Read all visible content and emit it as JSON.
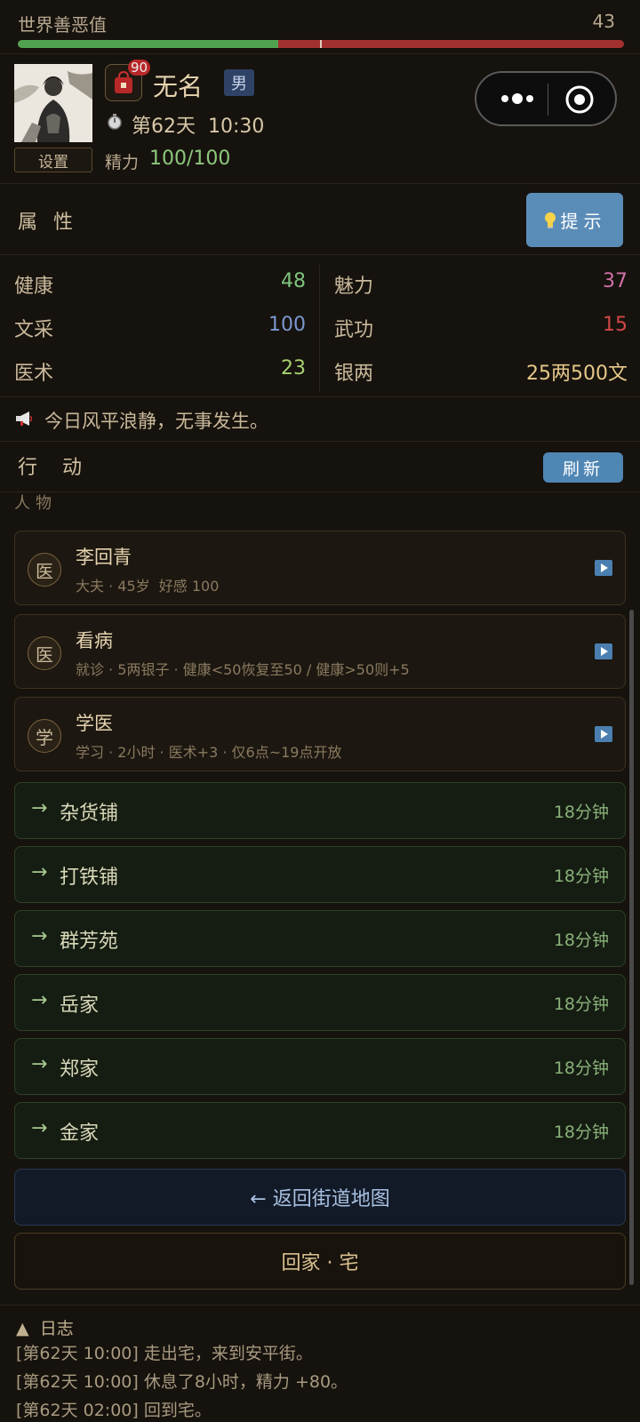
{
  "karma": {
    "label": "世界善恶值",
    "value": "43",
    "good_fraction": 0.43
  },
  "player": {
    "name": "无名",
    "gender": "男",
    "bag_count": "90",
    "day_time": "第62天  10:30",
    "stamina_label": "精力",
    "stamina_value": "100/100",
    "settings_label": "设置"
  },
  "attributes": {
    "title": "属性",
    "hint_label": "提示",
    "items": [
      {
        "label": "健康",
        "value": "48",
        "color": "#7ec47e"
      },
      {
        "label": "魅力",
        "value": "37",
        "color": "#d070a8"
      },
      {
        "label": "文采",
        "value": "100",
        "color": "#7a98d0"
      },
      {
        "label": "武功",
        "value": "15",
        "color": "#d04848"
      },
      {
        "label": "医术",
        "value": "23",
        "color": "#a8d070"
      },
      {
        "label": "银两",
        "value": "25两500文",
        "color": "#e6c88a"
      }
    ]
  },
  "news": {
    "text": "今日风平浪静，无事发生。"
  },
  "actions": {
    "title": "行动",
    "refresh_label": "刷新",
    "section_people": "人物",
    "cards": [
      {
        "badge": "医",
        "title": "李回青",
        "subtitle": "大夫 · 45岁  好感 100"
      },
      {
        "badge": "医",
        "title": "看病",
        "subtitle": "就诊 · 5两银子 · 健康<50恢复至50 / 健康>50则+5"
      },
      {
        "badge": "学",
        "title": "学医",
        "subtitle": "学习 · 2小时 · 医术+3 · 仅6点~19点开放"
      }
    ],
    "destinations": [
      {
        "arrow": "→",
        "name": "杂货铺",
        "time": "18分钟"
      },
      {
        "arrow": "→",
        "name": "打铁铺",
        "time": "18分钟"
      },
      {
        "arrow": "→",
        "name": "群芳苑",
        "time": "18分钟"
      },
      {
        "arrow": "→",
        "name": "岳家",
        "time": "18分钟"
      },
      {
        "arrow": "→",
        "name": "郑家",
        "time": "18分钟"
      },
      {
        "arrow": "→",
        "name": "金家",
        "time": "18分钟"
      }
    ],
    "back_label": "← 返回街道地图",
    "home_label": "回家 · 宅"
  },
  "log": {
    "title": "▲  日志",
    "lines": [
      "[第62天 10:00] 走出宅，来到安平街。",
      "[第62天 10:00] 休息了8小时，精力 +80。",
      "[第62天 02:00] 回到宅。"
    ]
  }
}
